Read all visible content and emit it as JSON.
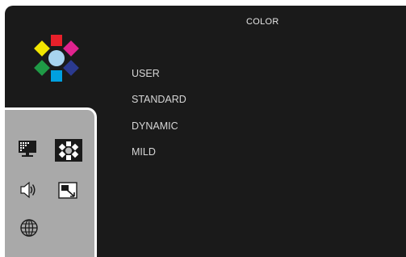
{
  "header": {
    "title": "COLOR"
  },
  "menu": {
    "items": [
      {
        "label": "USER"
      },
      {
        "label": "STANDARD"
      },
      {
        "label": "DYNAMIC"
      },
      {
        "label": "MILD"
      }
    ]
  },
  "sidebar": {
    "icons": [
      {
        "name": "picture-icon",
        "selected": false
      },
      {
        "name": "color-icon",
        "selected": true
      },
      {
        "name": "sound-icon",
        "selected": false
      },
      {
        "name": "screen-size-icon",
        "selected": false
      },
      {
        "name": "language-icon",
        "selected": false
      }
    ]
  },
  "colors": {
    "background": "#1a1a1a",
    "panel": "#a9a9a9",
    "petal_red": "#e8202a",
    "petal_magenta": "#e0238e",
    "petal_blue": "#2b3a8f",
    "petal_cyan": "#00a0e0",
    "petal_green": "#1f9a46",
    "petal_yellow": "#f2e600",
    "center": "#a8d4ef"
  }
}
